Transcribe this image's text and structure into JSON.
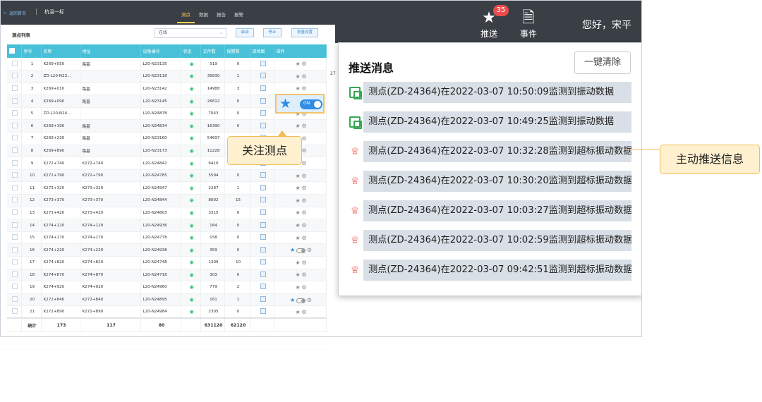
{
  "topbar": {
    "back_label": "返回首页",
    "project": "杭温一标",
    "tabs": [
      "测点",
      "数据",
      "报告",
      "报警"
    ],
    "active_tab": "测点",
    "push_label": "推送",
    "push_count": "35",
    "event_label": "事件",
    "greeting": "您好，宋平"
  },
  "panel": {
    "title": "测点列表",
    "filter_value": "在线",
    "buttons": [
      "启动",
      "停止",
      "批量设置"
    ],
    "side_number": "27"
  },
  "table": {
    "headers": [
      "序号",
      "名称",
      "地址",
      "设备编号",
      "状态",
      "文件数",
      "报警数",
      "现场图",
      "操作"
    ],
    "rows": [
      [
        "1",
        "K269+050",
        "路基",
        "L20-N23135",
        "519",
        "0"
      ],
      [
        "2",
        "ZD-L20-N23...",
        "",
        "L20-N23118",
        "35830",
        "1"
      ],
      [
        "3",
        "K269+010",
        "路基",
        "L20-N23142",
        "14988",
        "3"
      ],
      [
        "4",
        "K269+090",
        "路基",
        "L20-N23145",
        "26612",
        "0"
      ],
      [
        "5",
        "ZD-L20-N24...",
        "",
        "L20-N24878",
        "7043",
        "0"
      ],
      [
        "6",
        "K269+190",
        "路基",
        "L20-N24834",
        "16390",
        "0"
      ],
      [
        "7",
        "K269+230",
        "路基",
        "L20-N23160",
        "54697",
        "0"
      ],
      [
        "8",
        "K269+890",
        "路基",
        "L20-N23173",
        "11228",
        "45"
      ],
      [
        "9",
        "K272+740",
        "K272+740",
        "L20-N24842",
        "6410",
        "3"
      ],
      [
        "10",
        "K272+790",
        "K272+790",
        "L20-N24785",
        "5594",
        "0"
      ],
      [
        "11",
        "K273+320",
        "K273+320",
        "L20-N24947",
        "2287",
        "1"
      ],
      [
        "12",
        "K273+370",
        "K273+370",
        "L20-N24844",
        "8002",
        "15"
      ],
      [
        "13",
        "K273+420",
        "K273+420",
        "L20-N24803",
        "3315",
        "0"
      ],
      [
        "14",
        "K274+120",
        "K274+120",
        "L20-N24936",
        "164",
        "0"
      ],
      [
        "15",
        "K274+170",
        "K274+170",
        "L20-N24778",
        "158",
        "0"
      ],
      [
        "16",
        "K274+220",
        "K274+220",
        "L20-N24938",
        "359",
        "0"
      ],
      [
        "17",
        "K274+820",
        "K274+820",
        "L20-N24748",
        "1309",
        "10"
      ],
      [
        "18",
        "K274+870",
        "K274+870",
        "L20-N24718",
        "303",
        "0"
      ],
      [
        "19",
        "K274+920",
        "K274+920",
        "L20-N24960",
        "779",
        "2"
      ],
      [
        "20",
        "K272+840",
        "K272+840",
        "L20-N24895",
        "161",
        "1"
      ],
      [
        "21",
        "K272+890",
        "K272+890",
        "L20-N24984",
        "2305",
        "0"
      ]
    ],
    "totals": [
      "统计",
      "173",
      "117",
      "80",
      "631120",
      "62120"
    ]
  },
  "highlight_toggle": "ON",
  "callout_follow": "关注测点",
  "push_panel": {
    "title": "推送消息",
    "clear_button": "一键清除",
    "messages": [
      {
        "type": "data",
        "text": "测点(ZD-24364)在2022-03-07 10:50:09监测到振动数据"
      },
      {
        "type": "data",
        "text": "测点(ZD-24364)在2022-03-07 10:49:25监测到振动数据"
      },
      {
        "type": "alarm",
        "text": "测点(ZD-24364)在2022-03-07 10:32:28监测到超标振动数据"
      },
      {
        "type": "alarm",
        "text": "测点(ZD-24364)在2022-03-07 10:30:20监测到超标振动数据"
      },
      {
        "type": "alarm",
        "text": "测点(ZD-24364)在2022-03-07 10:03:27监测到超标振动数据"
      },
      {
        "type": "alarm",
        "text": "测点(ZD-24364)在2022-03-07 10:02:59监测到超标振动数据"
      },
      {
        "type": "alarm",
        "text": "测点(ZD-24364)在2022-03-07 09:42:51监测到超标振动数据"
      }
    ]
  },
  "callout_push": "主动推送信息",
  "colors": {
    "topbar": "#3a3f46",
    "table_header": "#47c0d8",
    "accent": "#2f8de4",
    "callout": "#fff0cf",
    "alarm": "#e5483c"
  }
}
